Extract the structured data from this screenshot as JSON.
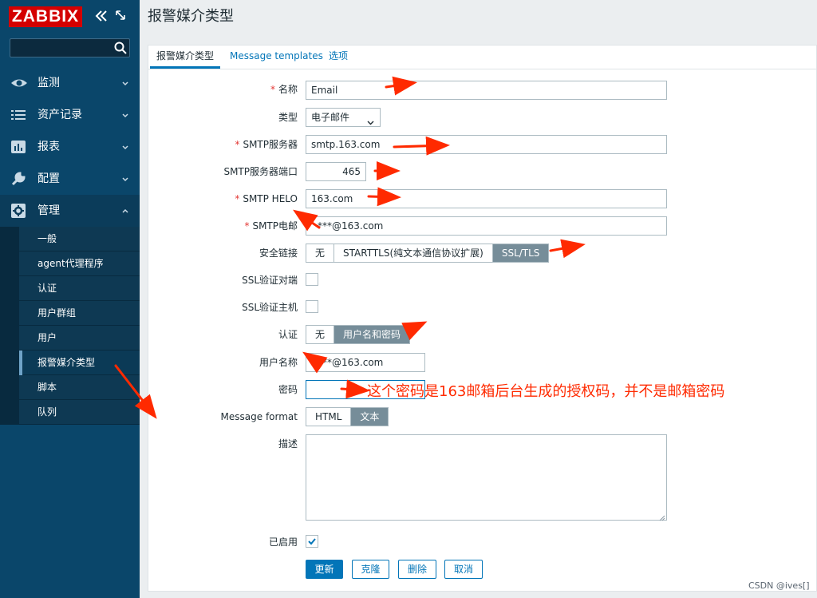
{
  "sidebar": {
    "logo": "ZABBIX",
    "search_placeholder": "",
    "items": [
      {
        "label": "监测",
        "icon": "eye-icon"
      },
      {
        "label": "资产记录",
        "icon": "list-icon"
      },
      {
        "label": "报表",
        "icon": "bar-chart-icon"
      },
      {
        "label": "配置",
        "icon": "wrench-icon"
      },
      {
        "label": "管理",
        "icon": "gear-icon"
      }
    ],
    "admin_submenu": [
      "一般",
      "agent代理程序",
      "认证",
      "用户群组",
      "用户",
      "报警媒介类型",
      "脚本",
      "队列"
    ],
    "selected_submenu": "报警媒介类型"
  },
  "page": {
    "title": "报警媒介类型"
  },
  "tabs": [
    "报警媒介类型",
    "Message templates",
    "选项"
  ],
  "form": {
    "name_label": "名称",
    "name_value": "Email",
    "type_label": "类型",
    "type_value": "电子邮件",
    "smtp_server_label": "SMTP服务器",
    "smtp_server_value": "smtp.163.com",
    "smtp_port_label": "SMTP服务器端口",
    "smtp_port_value": "465",
    "smtp_helo_label": "SMTP HELO",
    "smtp_helo_value": "163.com",
    "smtp_email_label": "SMTP电邮",
    "smtp_email_value": "***@163.com",
    "security_label": "安全链接",
    "security_options": [
      "无",
      "STARTTLS(纯文本通信协议扩展)",
      "SSL/TLS"
    ],
    "security_selected": "SSL/TLS",
    "ssl_verify_peer_label": "SSL验证对端",
    "ssl_verify_host_label": "SSL验证主机",
    "auth_label": "认证",
    "auth_options": [
      "无",
      "用户名和密码"
    ],
    "auth_selected": "用户名和密码",
    "username_label": "用户名称",
    "username_value": "***@163.com",
    "password_label": "密码",
    "password_value": "",
    "message_format_label": "Message format",
    "message_format_options": [
      "HTML",
      "文本"
    ],
    "message_format_selected": "文本",
    "description_label": "描述",
    "description_value": "",
    "enabled_label": "已启用",
    "enabled_checked": true,
    "buttons": {
      "update": "更新",
      "clone": "克隆",
      "delete": "删除",
      "cancel": "取消"
    }
  },
  "annotation": {
    "text": "这个密码是163邮箱后台生成的授权码，并不是邮箱密码",
    "color": "#ff2a00"
  },
  "watermark": "CSDN @ives[]",
  "colors": {
    "sidebar": "#0a466a",
    "logo_bg": "#d40000",
    "accent": "#0275b8",
    "segment_on": "#768d99",
    "required": "#e33734"
  }
}
